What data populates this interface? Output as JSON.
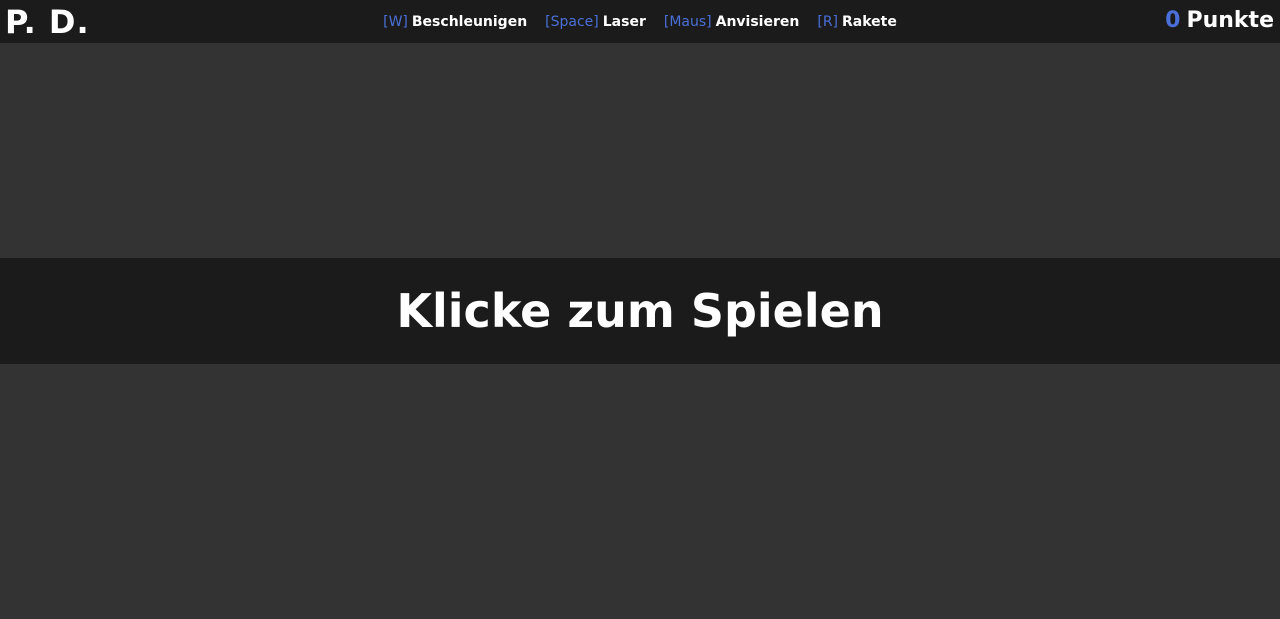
{
  "header": {
    "logo": "P. D.",
    "controls": [
      {
        "key": "[W]",
        "action": "Beschleunigen"
      },
      {
        "key": "[Space]",
        "action": "Laser"
      },
      {
        "key": "[Maus]",
        "action": "Anvisieren"
      },
      {
        "key": "[R]",
        "action": "Rakete"
      }
    ],
    "score": {
      "value": "0",
      "label": "Punkte"
    }
  },
  "game": {
    "start_prompt": "Klicke zum Spielen"
  },
  "colors": {
    "background": "#333333",
    "bars": "#1b1b1b",
    "accent": "#4a6fd8",
    "text": "#ffffff"
  }
}
